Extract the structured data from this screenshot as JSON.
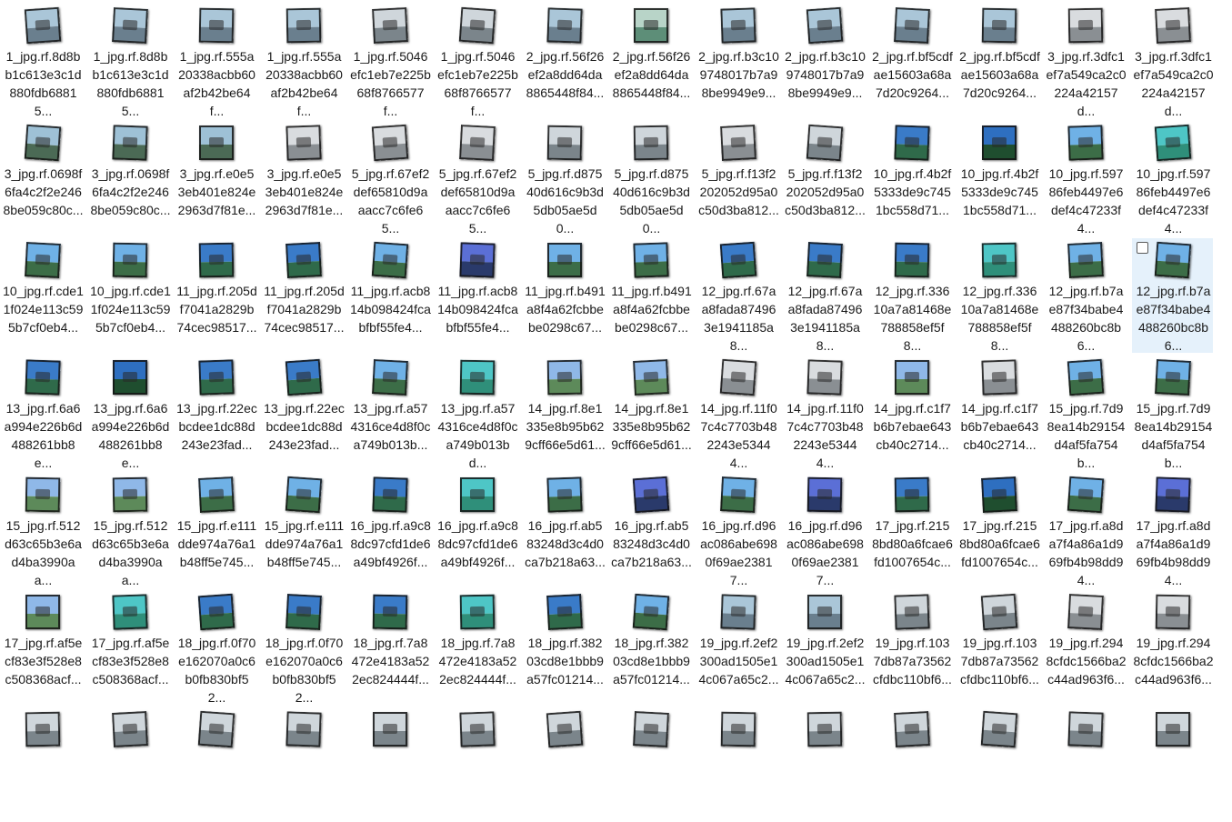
{
  "selected_index": 41,
  "thumb_styles": {
    "A": {
      "sky": "#aac6d8",
      "ground": "#6a7f8e"
    },
    "B": {
      "sky": "#b8d4c8",
      "ground": "#5d8e78"
    },
    "C": {
      "sky": "#cfd6db",
      "ground": "#7b858b"
    },
    "D": {
      "sky": "#9ec1d6",
      "ground": "#4b6a55"
    },
    "E": {
      "sky": "#d9dcdf",
      "ground": "#8a8f93"
    },
    "F": {
      "sky": "#3a7bc8",
      "ground": "#2f6a4a"
    },
    "G": {
      "sky": "#2e6fc0",
      "ground": "#1f4e2f"
    },
    "H": {
      "sky": "#6fb1e6",
      "ground": "#3c6d47"
    },
    "I": {
      "sky": "#4ec6c6",
      "ground": "#2f8f7a"
    },
    "J": {
      "sky": "#5b6fd6",
      "ground": "#2a3a6b"
    },
    "K": {
      "sky": "#8fb8e8",
      "ground": "#5d8a5a"
    }
  },
  "files": [
    {
      "name": "1_jpg.rf.8d8bb1c613e3c1d880fdb68815...",
      "style": "A"
    },
    {
      "name": "1_jpg.rf.8d8bb1c613e3c1d880fdb68815...",
      "style": "A"
    },
    {
      "name": "1_jpg.rf.555a20338acbb60af2b42be64f...",
      "style": "A"
    },
    {
      "name": "1_jpg.rf.555a20338acbb60af2b42be64f...",
      "style": "A"
    },
    {
      "name": "1_jpg.rf.5046efc1eb7e225b68f8766577f...",
      "style": "C"
    },
    {
      "name": "1_jpg.rf.5046efc1eb7e225b68f8766577f...",
      "style": "C"
    },
    {
      "name": "2_jpg.rf.56f26ef2a8dd64da8865448f84...",
      "style": "A"
    },
    {
      "name": "2_jpg.rf.56f26ef2a8dd64da8865448f84...",
      "style": "B"
    },
    {
      "name": "2_jpg.rf.b3c109748017b7a98be9949e9...",
      "style": "A"
    },
    {
      "name": "2_jpg.rf.b3c109748017b7a98be9949e9...",
      "style": "A"
    },
    {
      "name": "2_jpg.rf.bf5cdfae15603a68a7d20c9264...",
      "style": "A"
    },
    {
      "name": "2_jpg.rf.bf5cdfae15603a68a7d20c9264...",
      "style": "A"
    },
    {
      "name": "3_jpg.rf.3dfc1ef7a549ca2c0224a42157d...",
      "style": "E"
    },
    {
      "name": "3_jpg.rf.3dfc1ef7a549ca2c0224a42157d...",
      "style": "E"
    },
    {
      "name": "3_jpg.rf.0698f6fa4c2f2e2468be059c80c...",
      "style": "D"
    },
    {
      "name": "3_jpg.rf.0698f6fa4c2f2e2468be059c80c...",
      "style": "D"
    },
    {
      "name": "3_jpg.rf.e0e53eb401e824e2963d7f81e...",
      "style": "D"
    },
    {
      "name": "3_jpg.rf.e0e53eb401e824e2963d7f81e...",
      "style": "E"
    },
    {
      "name": "5_jpg.rf.67ef2def65810d9aaacc7c6fe65...",
      "style": "E"
    },
    {
      "name": "5_jpg.rf.67ef2def65810d9aaacc7c6fe65...",
      "style": "E"
    },
    {
      "name": "5_jpg.rf.d87540d616c9b3d5db05ae5d0...",
      "style": "C"
    },
    {
      "name": "5_jpg.rf.d87540d616c9b3d5db05ae5d0...",
      "style": "C"
    },
    {
      "name": "5_jpg.rf.f13f2202052d95a0c50d3ba812...",
      "style": "E"
    },
    {
      "name": "5_jpg.rf.f13f2202052d95a0c50d3ba812...",
      "style": "C"
    },
    {
      "name": "10_jpg.rf.4b2f5333de9c7451bc558d71...",
      "style": "F"
    },
    {
      "name": "10_jpg.rf.4b2f5333de9c7451bc558d71...",
      "style": "G"
    },
    {
      "name": "10_jpg.rf.59786feb4497e6def4c47233f4...",
      "style": "H"
    },
    {
      "name": "10_jpg.rf.59786feb4497e6def4c47233f4...",
      "style": "I"
    },
    {
      "name": "10_jpg.rf.cde11f024e113c595b7cf0eb4...",
      "style": "H"
    },
    {
      "name": "10_jpg.rf.cde11f024e113c595b7cf0eb4...",
      "style": "H"
    },
    {
      "name": "11_jpg.rf.205df7041a2829b74cec98517...",
      "style": "F"
    },
    {
      "name": "11_jpg.rf.205df7041a2829b74cec98517...",
      "style": "F"
    },
    {
      "name": "11_jpg.rf.acb814b098424fcabfbf55fe4...",
      "style": "H"
    },
    {
      "name": "11_jpg.rf.acb814b098424fcabfbf55fe4...",
      "style": "J"
    },
    {
      "name": "11_jpg.rf.b491a8f4a62fcbbebe0298c67...",
      "style": "H"
    },
    {
      "name": "11_jpg.rf.b491a8f4a62fcbbebe0298c67...",
      "style": "H"
    },
    {
      "name": "12_jpg.rf.67aa8fada874963e1941185a8...",
      "style": "F"
    },
    {
      "name": "12_jpg.rf.67aa8fada874963e1941185a8...",
      "style": "F"
    },
    {
      "name": "12_jpg.rf.33610a7a81468e788858ef5f8...",
      "style": "F"
    },
    {
      "name": "12_jpg.rf.33610a7a81468e788858ef5f8...",
      "style": "I"
    },
    {
      "name": "12_jpg.rf.b7ae87f34babe4488260bc8b6...",
      "style": "H"
    },
    {
      "name": "12_jpg.rf.b7ae87f34babe4488260bc8b6...",
      "style": "H"
    },
    {
      "name": "13_jpg.rf.6a6a994e226b6d488261bb8e...",
      "style": "F"
    },
    {
      "name": "13_jpg.rf.6a6a994e226b6d488261bb8e...",
      "style": "G"
    },
    {
      "name": "13_jpg.rf.22ecbcdee1dc88d243e23fad...",
      "style": "F"
    },
    {
      "name": "13_jpg.rf.22ecbcdee1dc88d243e23fad...",
      "style": "F"
    },
    {
      "name": "13_jpg.rf.a574316ce4d8f0ca749b013b...",
      "style": "H"
    },
    {
      "name": "13_jpg.rf.a574316ce4d8f0ca749b013bd...",
      "style": "I"
    },
    {
      "name": "14_jpg.rf.8e1335e8b95b629cff66e5d61...",
      "style": "K"
    },
    {
      "name": "14_jpg.rf.8e1335e8b95b629cff66e5d61...",
      "style": "K"
    },
    {
      "name": "14_jpg.rf.11f07c4c7703b482243e53444...",
      "style": "E"
    },
    {
      "name": "14_jpg.rf.11f07c4c7703b482243e53444...",
      "style": "E"
    },
    {
      "name": "14_jpg.rf.c1f7b6b7ebae643cb40c2714...",
      "style": "K"
    },
    {
      "name": "14_jpg.rf.c1f7b6b7ebae643cb40c2714...",
      "style": "E"
    },
    {
      "name": "15_jpg.rf.7d98ea14b29154d4af5fa754b...",
      "style": "H"
    },
    {
      "name": "15_jpg.rf.7d98ea14b29154d4af5fa754b...",
      "style": "H"
    },
    {
      "name": "15_jpg.rf.512d63c65b3e6ad4ba3990aa...",
      "style": "K"
    },
    {
      "name": "15_jpg.rf.512d63c65b3e6ad4ba3990aa...",
      "style": "K"
    },
    {
      "name": "15_jpg.rf.e111dde974a76a1b48ff5e745...",
      "style": "H"
    },
    {
      "name": "15_jpg.rf.e111dde974a76a1b48ff5e745...",
      "style": "H"
    },
    {
      "name": "16_jpg.rf.a9c88dc97cfd1de6a49bf4926f...",
      "style": "F"
    },
    {
      "name": "16_jpg.rf.a9c88dc97cfd1de6a49bf4926f...",
      "style": "I"
    },
    {
      "name": "16_jpg.rf.ab583248d3c4d0ca7b218a63...",
      "style": "H"
    },
    {
      "name": "16_jpg.rf.ab583248d3c4d0ca7b218a63...",
      "style": "J"
    },
    {
      "name": "16_jpg.rf.d96ac086abe6980f69ae23817...",
      "style": "H"
    },
    {
      "name": "16_jpg.rf.d96ac086abe6980f69ae23817...",
      "style": "J"
    },
    {
      "name": "17_jpg.rf.2158bd80a6fcae6fd1007654c...",
      "style": "F"
    },
    {
      "name": "17_jpg.rf.2158bd80a6fcae6fd1007654c...",
      "style": "G"
    },
    {
      "name": "17_jpg.rf.a8da7f4a86a1d969fb4b98dd94...",
      "style": "H"
    },
    {
      "name": "17_jpg.rf.a8da7f4a86a1d969fb4b98dd94...",
      "style": "J"
    },
    {
      "name": "17_jpg.rf.af5ecf83e3f528e8c508368acf...",
      "style": "K"
    },
    {
      "name": "17_jpg.rf.af5ecf83e3f528e8c508368acf...",
      "style": "I"
    },
    {
      "name": "18_jpg.rf.0f70e162070a0c6b0fb830bf52...",
      "style": "F"
    },
    {
      "name": "18_jpg.rf.0f70e162070a0c6b0fb830bf52...",
      "style": "F"
    },
    {
      "name": "18_jpg.rf.7a8472e4183a522ec824444f...",
      "style": "F"
    },
    {
      "name": "18_jpg.rf.7a8472e4183a522ec824444f...",
      "style": "I"
    },
    {
      "name": "18_jpg.rf.38203cd8e1bbb9a57fc01214...",
      "style": "F"
    },
    {
      "name": "18_jpg.rf.38203cd8e1bbb9a57fc01214...",
      "style": "H"
    },
    {
      "name": "19_jpg.rf.2ef2300ad1505e14c067a65c2...",
      "style": "A"
    },
    {
      "name": "19_jpg.rf.2ef2300ad1505e14c067a65c2...",
      "style": "A"
    },
    {
      "name": "19_jpg.rf.1037db87a73562cfdbc110bf6...",
      "style": "C"
    },
    {
      "name": "19_jpg.rf.1037db87a73562cfdbc110bf6...",
      "style": "C"
    },
    {
      "name": "19_jpg.rf.2948cfdc1566ba2c44ad963f6...",
      "style": "E"
    },
    {
      "name": "19_jpg.rf.2948cfdc1566ba2c44ad963f6...",
      "style": "E"
    },
    {
      "name": "",
      "style": "C"
    },
    {
      "name": "",
      "style": "C"
    },
    {
      "name": "",
      "style": "C"
    },
    {
      "name": "",
      "style": "C"
    },
    {
      "name": "",
      "style": "C"
    },
    {
      "name": "",
      "style": "C"
    },
    {
      "name": "",
      "style": "C"
    },
    {
      "name": "",
      "style": "C"
    },
    {
      "name": "",
      "style": "C"
    },
    {
      "name": "",
      "style": "C"
    },
    {
      "name": "",
      "style": "C"
    },
    {
      "name": "",
      "style": "C"
    },
    {
      "name": "",
      "style": "C"
    },
    {
      "name": "",
      "style": "C"
    }
  ]
}
